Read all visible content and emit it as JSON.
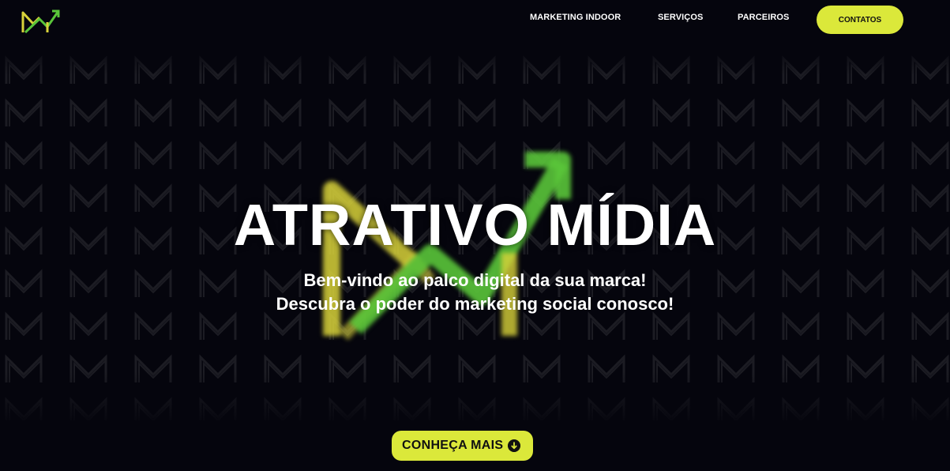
{
  "nav": {
    "items": [
      "MARKETING INDOOR",
      "SERVIÇOS",
      "PARCEIROS"
    ],
    "cta_label": "CONTATOS"
  },
  "hero": {
    "title": "ATRATIVO MÍDIA",
    "subtitle_line1": "Bem-vindo ao palco digital da sua marca!",
    "subtitle_line2": "Descubra o poder do marketing social conosco!",
    "cta_label": "CONHEÇA MAIS"
  },
  "icons": {
    "logo": "m-arrow-logo-icon",
    "cta": "arrow-down-circle-icon"
  },
  "colors": {
    "background": "#05050d",
    "accent": "#dbe83a",
    "logo_yellow": "#d8d23a",
    "logo_green": "#5ac53a"
  }
}
